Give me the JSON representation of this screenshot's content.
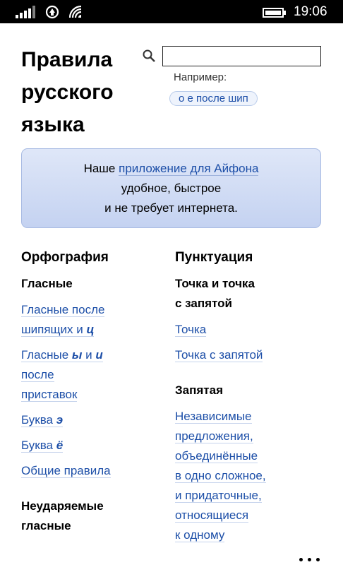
{
  "status_bar": {
    "time": "19:06",
    "icons": [
      "signal-icon",
      "sim-icon",
      "wifi-icon",
      "battery-icon"
    ]
  },
  "header": {
    "title_lines": [
      "Правила",
      "русского",
      "языка"
    ],
    "search": {
      "value": "",
      "placeholder": ""
    },
    "example_label": "Например:",
    "example_chip": "о е после шип"
  },
  "promo": {
    "prefix": "Наше ",
    "link": "приложение для Айфона",
    "line2": "удобное, быстрое",
    "line3": "и не требует интернета."
  },
  "left_column": {
    "title": "Орфография",
    "subsections": [
      {
        "title": "Гласные",
        "links": [
          {
            "parts": [
              "Гласные после",
              "шипящих и ",
              "ц"
            ]
          },
          {
            "parts": [
              "Гласные ",
              "ы",
              " и ",
              "и",
              "после",
              "приставок"
            ]
          },
          {
            "parts": [
              "Буква ",
              "э"
            ]
          },
          {
            "parts": [
              "Буква ",
              "ё"
            ]
          },
          {
            "parts": [
              "Общие правила"
            ]
          }
        ]
      },
      {
        "title_lines": [
          "Неударяемые",
          "гласные"
        ]
      }
    ]
  },
  "right_column": {
    "title": "Пунктуация",
    "subsections": [
      {
        "title_lines": [
          "Точка и точка",
          "с запятой"
        ],
        "links": [
          "Точка",
          "Точка с запятой"
        ]
      },
      {
        "title": "Запятая",
        "links": [
          {
            "lines": [
              "Независимые",
              "предложения,",
              "объединённые",
              "в одно сложное,",
              "и придаточные,",
              "относящиеся",
              "к одному"
            ]
          }
        ]
      }
    ]
  },
  "colors": {
    "link": "#1d4fa8",
    "promo_bg": "#c8d6f2",
    "promo_border": "#a8bbe3",
    "status_bar_bg": "#000000"
  }
}
